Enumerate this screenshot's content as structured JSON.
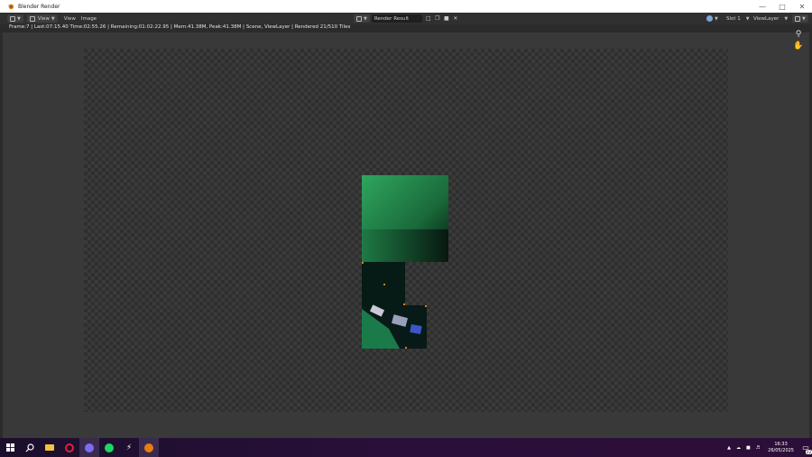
{
  "window": {
    "title": "Blender Render"
  },
  "header": {
    "menu_view": "View",
    "menu_view2": "View",
    "menu_image": "Image",
    "image_name": "Render Result",
    "slot": "Slot 1",
    "view_layer": "ViewLayer"
  },
  "status": {
    "text": "Frame:7 | Last:07:15.40 Time:02:55.26 | Remaining:01:02:22.95 | Mem:41.38M, Peak:41.38M | Scene, ViewLayer | Rendered 21/510 Tiles"
  },
  "taskbar": {
    "time": "16:33",
    "date": "26/05/2025",
    "notification_count": "22"
  },
  "colors": {
    "accent": "#e87d0d",
    "render_green": "#1f8a4a",
    "taskbar": "#2a0f3a"
  }
}
